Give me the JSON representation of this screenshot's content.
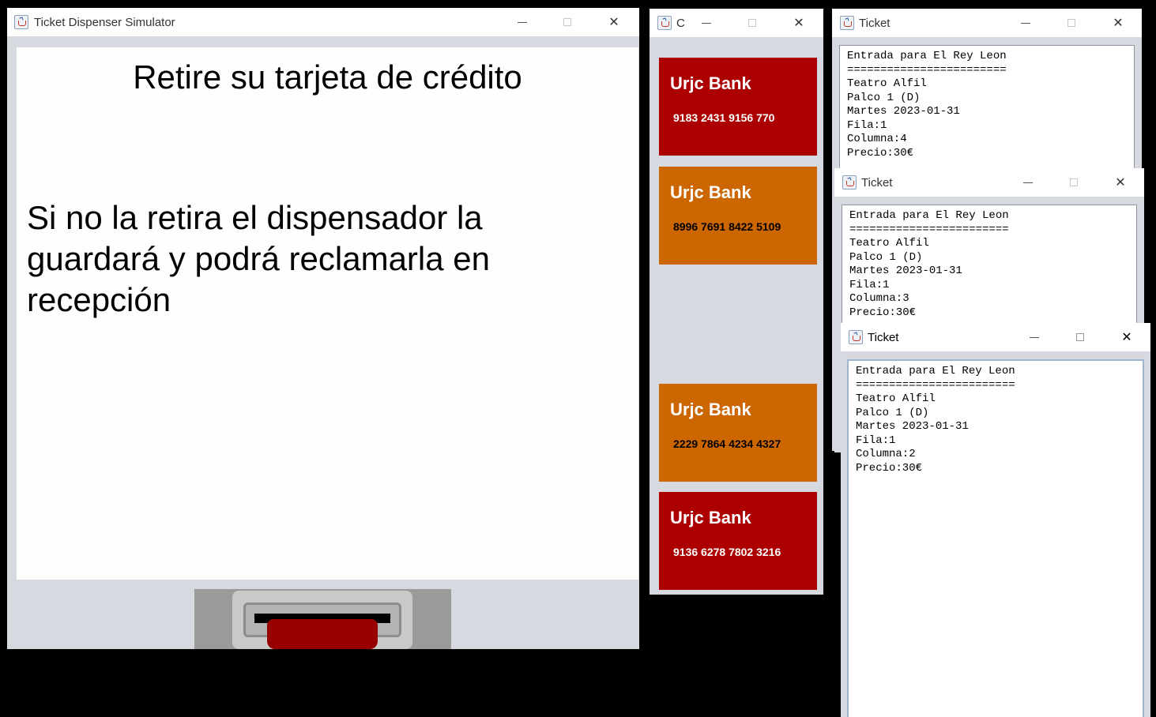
{
  "main_window": {
    "title": "Ticket Dispenser Simulator",
    "message_title": "Retire su tarjeta de crédito",
    "message_body": "Si no la retira el dispensador la guardará y podrá reclamarla en recepción"
  },
  "cards_window": {
    "title": "C",
    "cards": [
      {
        "bank": "Urjc Bank",
        "number": "9183 2431 9156 770",
        "color": "#ac0000"
      },
      {
        "bank": "Urjc Bank",
        "number": "8996 7691 8422 5109",
        "color": "#cc6600"
      },
      {
        "bank": "Urjc Bank",
        "number": "2229 7864 4234 4327",
        "color": "#cc6600"
      },
      {
        "bank": "Urjc Bank",
        "number": "9136 6278 7802 3216",
        "color": "#ac0000"
      }
    ]
  },
  "ticket_windows": [
    {
      "title": "Ticket",
      "lines": [
        "Entrada para El Rey Leon",
        "========================",
        "Teatro Alfil",
        "Palco 1 (D)",
        "Martes 2023-01-31",
        "Fila:1",
        "Columna:4",
        "Precio:30€"
      ]
    },
    {
      "title": "Ticket",
      "lines": [
        "Entrada para El Rey Leon",
        "========================",
        "Teatro Alfil",
        "Palco 1 (D)",
        "Martes 2023-01-31",
        "Fila:1",
        "Columna:3",
        "Precio:30€"
      ]
    },
    {
      "title": "Ticket",
      "lines": [
        "Entrada para El Rey Leon",
        "========================",
        "Teatro Alfil",
        "Palco 1 (D)",
        "Martes 2023-01-31",
        "Fila:1",
        "Columna:2",
        "Precio:30€"
      ]
    }
  ]
}
